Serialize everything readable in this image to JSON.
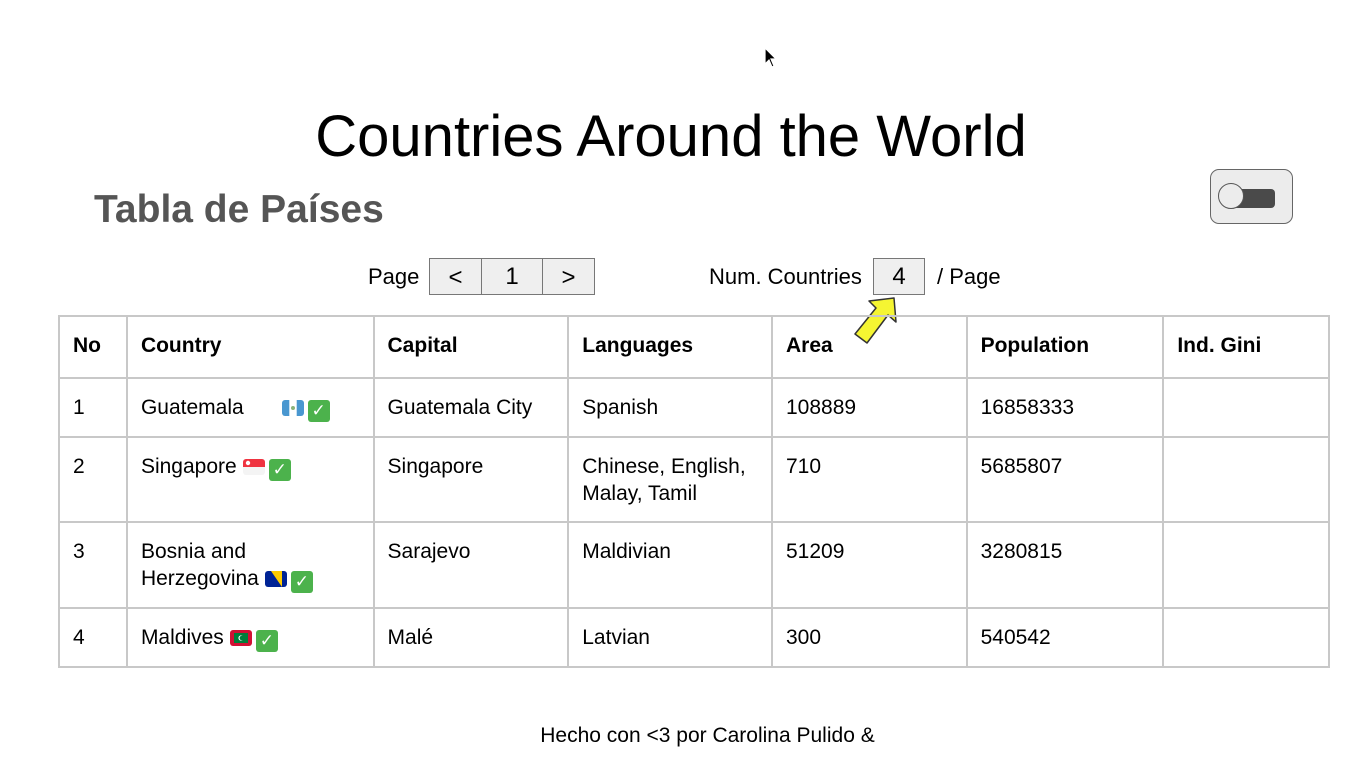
{
  "header": {
    "title": "Countries Around the World",
    "subtitle": "Tabla de Países"
  },
  "theme_toggle": {
    "state": "off"
  },
  "pagination": {
    "page_label": "Page",
    "prev_label": "<",
    "current_page": "1",
    "next_label": ">",
    "num_label": "Num. Countries",
    "num_value": "4",
    "per_page_label": "/ Page"
  },
  "table": {
    "columns": [
      "No",
      "Country",
      "Capital",
      "Languages",
      "Area",
      "Population",
      "Ind. Gini"
    ],
    "rows": [
      {
        "no": "1",
        "country": "Guatemala",
        "flag": "guatemala-flag-icon",
        "capital": "Guatemala City",
        "languages": "Spanish",
        "area": "108889",
        "population": "16858333",
        "gini": ""
      },
      {
        "no": "2",
        "country": "Singapore",
        "flag": "singapore-flag-icon",
        "capital": "Singapore",
        "languages": "Chinese, English, Malay, Tamil",
        "area": "710",
        "population": "5685807",
        "gini": ""
      },
      {
        "no": "3",
        "country": "Bosnia and Herzegovina",
        "flag": "bosnia-flag-icon",
        "capital": "Sarajevo",
        "languages": "Maldivian",
        "area": "51209",
        "population": "3280815",
        "gini": ""
      },
      {
        "no": "4",
        "country": "Maldives",
        "flag": "maldives-flag-icon",
        "capital": "Malé",
        "languages": "Latvian",
        "area": "300",
        "population": "540542",
        "gini": ""
      }
    ]
  },
  "footer": {
    "text": "Hecho con <3 por Carolina Pulido &"
  },
  "colors": {
    "subtitle": "#555555",
    "check": "#4cb24c",
    "arrow": "#f5f532",
    "border": "#c8c8c8"
  }
}
